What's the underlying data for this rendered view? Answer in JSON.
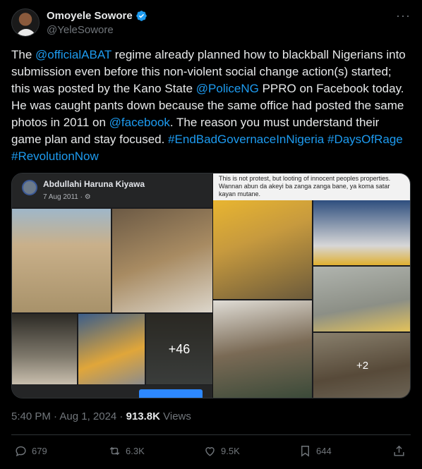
{
  "author": {
    "display_name": "Omoyele Sowore",
    "handle": "@YeleSowore"
  },
  "menu": {
    "more_label": "···"
  },
  "tweet": {
    "segments": [
      {
        "text": "The ",
        "link": false
      },
      {
        "text": "@officialABAT",
        "link": true
      },
      {
        "text": " regime already planned how to blackball Nigerians into submission even before this non-violent social change action(s) started; this was posted by the Kano State ",
        "link": false
      },
      {
        "text": "@PoliceNG",
        "link": true
      },
      {
        "text": " PPRO on Facebook today.  He was caught pants down because the same office had posted the same photos in 2011 on ",
        "link": false
      },
      {
        "text": "@facebook",
        "link": true
      },
      {
        "text": ". The reason you must understand their game plan and stay focused. ",
        "link": false
      },
      {
        "text": "#EndBadGovernaceInNigeria",
        "link": true
      },
      {
        "text": " ",
        "link": false
      },
      {
        "text": "#DaysOfRage",
        "link": true
      },
      {
        "text": " ",
        "link": false
      },
      {
        "text": "#RevolutionNow",
        "link": true
      }
    ]
  },
  "media": {
    "left_post": {
      "name": "Abdullahi Haruna Kiyawa",
      "date": "7 Aug 2011 · ⚙",
      "more_count": "+46"
    },
    "right_post": {
      "caption": "This is not protest, but looting of innocent peoples properties. Wannan abun da akeyi ba zanga zanga bane, ya koma satar kayan mutane.",
      "more_count": "+2"
    }
  },
  "meta": {
    "time_date": "5:40 PM · Aug 1, 2024 · ",
    "views_count": "913.8K",
    "views_label": " Views"
  },
  "actions": {
    "replies": "679",
    "reposts": "6.3K",
    "likes": "9.5K",
    "bookmarks": "644"
  },
  "colors": {
    "background": "#000000",
    "link": "#1d9bf0",
    "muted": "#71767b",
    "text": "#e7e9ea"
  }
}
